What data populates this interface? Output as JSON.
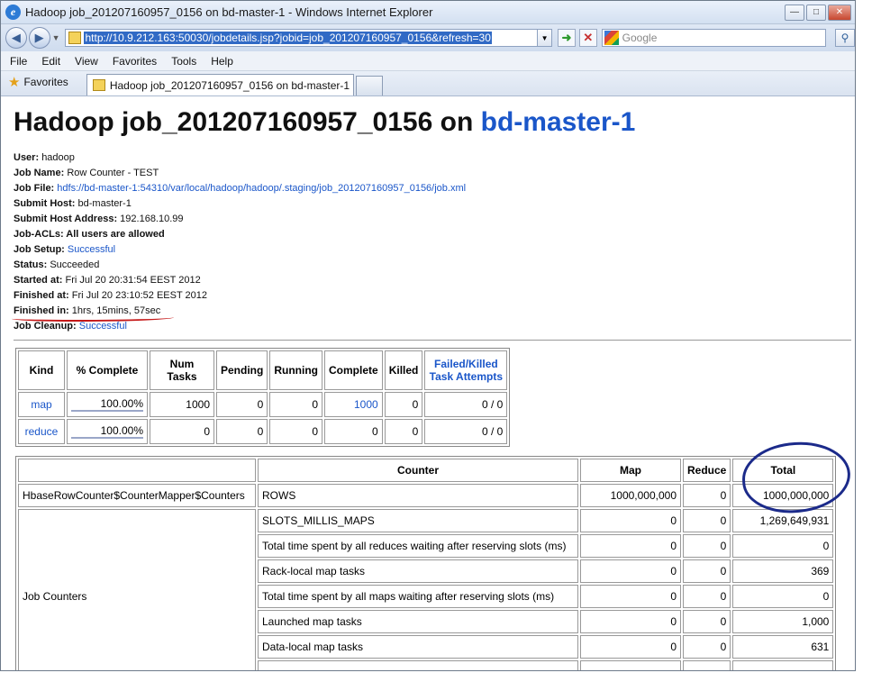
{
  "browser": {
    "window_title": "Hadoop job_201207160957_0156 on bd-master-1 - Windows Internet Explorer",
    "url": "http://10.9.212.163:50030/jobdetails.jsp?jobid=job_201207160957_0156&refresh=30",
    "search_placeholder": "Google",
    "menu": [
      "File",
      "Edit",
      "View",
      "Favorites",
      "Tools",
      "Help"
    ],
    "favorites_label": "Favorites",
    "tab_title": "Hadoop job_201207160957_0156 on bd-master-1"
  },
  "page": {
    "title_prefix": "Hadoop job_201207160957_0156 on ",
    "title_host": "bd-master-1",
    "info": [
      {
        "label": "User:",
        "value": "hadoop",
        "link": false
      },
      {
        "label": "Job Name:",
        "value": "Row Counter - TEST",
        "link": false
      },
      {
        "label": "Job File:",
        "value": "hdfs://bd-master-1:54310/var/local/hadoop/hadoop/.staging/job_201207160957_0156/job.xml",
        "link": true
      },
      {
        "label": "Submit Host:",
        "value": "bd-master-1",
        "link": false
      },
      {
        "label": "Submit Host Address:",
        "value": "192.168.10.99",
        "link": false
      },
      {
        "label": "Job-ACLs: All users are allowed",
        "value": "",
        "link": false
      },
      {
        "label": "Job Setup:",
        "value": "Successful",
        "link": true
      },
      {
        "label": "Status:",
        "value": "Succeeded",
        "link": false
      },
      {
        "label": "Started at:",
        "value": "Fri Jul 20 20:31:54 EEST 2012",
        "link": false
      },
      {
        "label": "Finished at:",
        "value": "Fri Jul 20 23:10:52 EEST 2012",
        "link": false
      },
      {
        "label": "Finished in:",
        "value": "1hrs, 15mins, 57sec",
        "link": false
      },
      {
        "label": "Job Cleanup:",
        "value": "Successful",
        "link": true
      }
    ],
    "kind_table": {
      "headers": [
        "Kind",
        "% Complete",
        "Num Tasks",
        "Pending",
        "Running",
        "Complete",
        "Killed",
        "Failed/Killed Task Attempts"
      ],
      "rows": [
        {
          "kind": "map",
          "pct": "100.00%",
          "num_tasks": "1000",
          "pending": "0",
          "running": "0",
          "complete": "1000",
          "complete_link": true,
          "killed": "0",
          "failed": "0 / 0"
        },
        {
          "kind": "reduce",
          "pct": "100.00%",
          "num_tasks": "0",
          "pending": "0",
          "running": "0",
          "complete": "0",
          "complete_link": false,
          "killed": "0",
          "failed": "0 / 0"
        }
      ]
    },
    "counter_table": {
      "headers": [
        "",
        "Counter",
        "Map",
        "Reduce",
        "Total"
      ],
      "groups": [
        {
          "name": "HbaseRowCounter$CounterMapper$Counters",
          "rows": [
            {
              "counter": "ROWS",
              "map": "1000,000,000",
              "reduce": "0",
              "total": "1000,000,000"
            }
          ]
        },
        {
          "name": "Job Counters",
          "rows": [
            {
              "counter": "SLOTS_MILLIS_MAPS",
              "map": "0",
              "reduce": "0",
              "total": "1,269,649,931"
            },
            {
              "counter": "Total time spent by all reduces waiting after reserving slots (ms)",
              "map": "0",
              "reduce": "0",
              "total": "0"
            },
            {
              "counter": "Rack-local map tasks",
              "map": "0",
              "reduce": "0",
              "total": "369"
            },
            {
              "counter": "Total time spent by all maps waiting after reserving slots (ms)",
              "map": "0",
              "reduce": "0",
              "total": "0"
            },
            {
              "counter": "Launched map tasks",
              "map": "0",
              "reduce": "0",
              "total": "1,000"
            },
            {
              "counter": "Data-local map tasks",
              "map": "0",
              "reduce": "0",
              "total": "631"
            }
          ]
        }
      ]
    }
  }
}
